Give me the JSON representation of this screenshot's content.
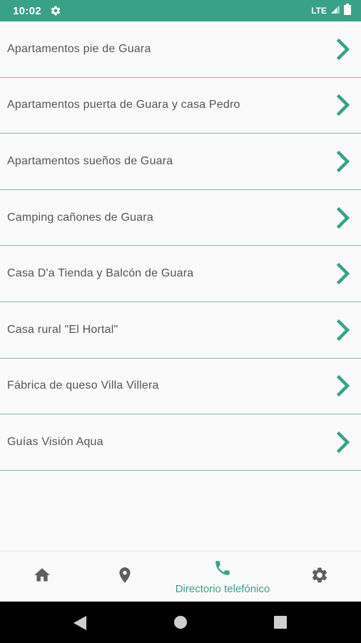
{
  "status_bar": {
    "time": "10:02",
    "network": "LTE",
    "icons": [
      "settings-gear-icon",
      "signal-icon",
      "battery-icon"
    ]
  },
  "list": {
    "items": [
      {
        "label": "Apartamentos pie de Guara"
      },
      {
        "label": "Apartamentos puerta de Guara y casa Pedro"
      },
      {
        "label": "Apartamentos sueños de Guara"
      },
      {
        "label": "Camping cañones de Guara"
      },
      {
        "label": "Casa D'a Tienda y Balcón de Guara"
      },
      {
        "label": "Casa rural \"El Hortal\""
      },
      {
        "label": "Fábrica de queso Villa Villera"
      },
      {
        "label": "Guías Visión Aqua"
      }
    ],
    "item_icon": "chevron-right-icon"
  },
  "bottom_nav": {
    "items": [
      {
        "icon": "home-icon",
        "active": false
      },
      {
        "icon": "location-pin-icon",
        "active": false
      },
      {
        "icon": "phone-icon",
        "label": "Directorio telefónico",
        "active": true
      },
      {
        "icon": "settings-icon",
        "active": false
      }
    ]
  },
  "system_nav": {
    "buttons": [
      "back-icon",
      "home-circle-icon",
      "recents-icon"
    ]
  },
  "colors": {
    "accent": "#3aa189",
    "divider": "#86b9ad",
    "text": "#555555",
    "icon_inactive": "#5f5f5f",
    "background": "#fafafa"
  }
}
